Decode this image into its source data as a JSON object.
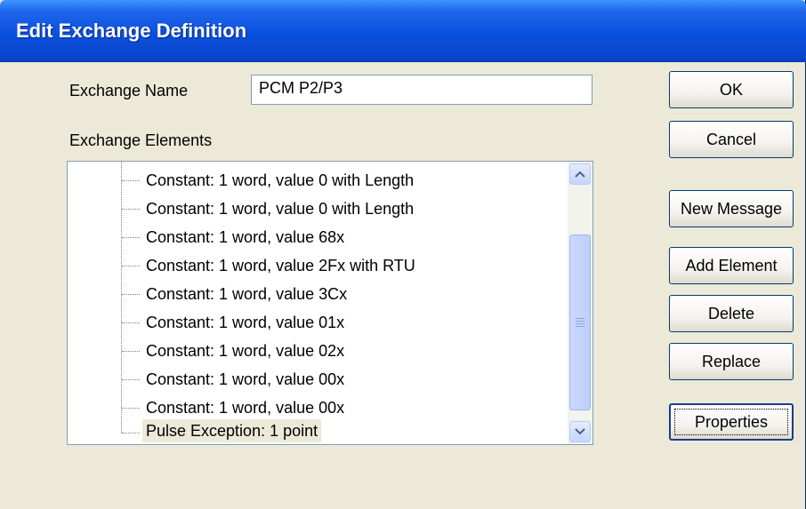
{
  "window": {
    "title": "Edit Exchange Definition"
  },
  "form": {
    "exchange_name_label": "Exchange Name",
    "exchange_name_value": "PCM P2/P3",
    "exchange_elements_label": "Exchange Elements"
  },
  "tree": {
    "items": [
      {
        "label": "Constant: 1 word, value 0 with Length"
      },
      {
        "label": "Constant: 1 word, value 0 with Length"
      },
      {
        "label": "Constant: 1 word, value 68x"
      },
      {
        "label": "Constant: 1 word, value 2Fx with RTU"
      },
      {
        "label": "Constant: 1 word, value 3Cx"
      },
      {
        "label": "Constant: 1 word, value 01x"
      },
      {
        "label": "Constant: 1 word, value 02x"
      },
      {
        "label": "Constant: 1 word, value 00x"
      },
      {
        "label": "Constant: 1 word, value 00x"
      },
      {
        "label": "Pulse Exception: 1 point",
        "selected": true
      }
    ]
  },
  "buttons": {
    "ok": "OK",
    "cancel": "Cancel",
    "new_message": "New Message",
    "add_element": "Add Element",
    "delete": "Delete",
    "replace": "Replace",
    "properties": "Properties"
  },
  "colors": {
    "title_bar": "#0a4fde",
    "dialog_bg": "#ece9d8",
    "selection_bg": "#ece9d8"
  }
}
